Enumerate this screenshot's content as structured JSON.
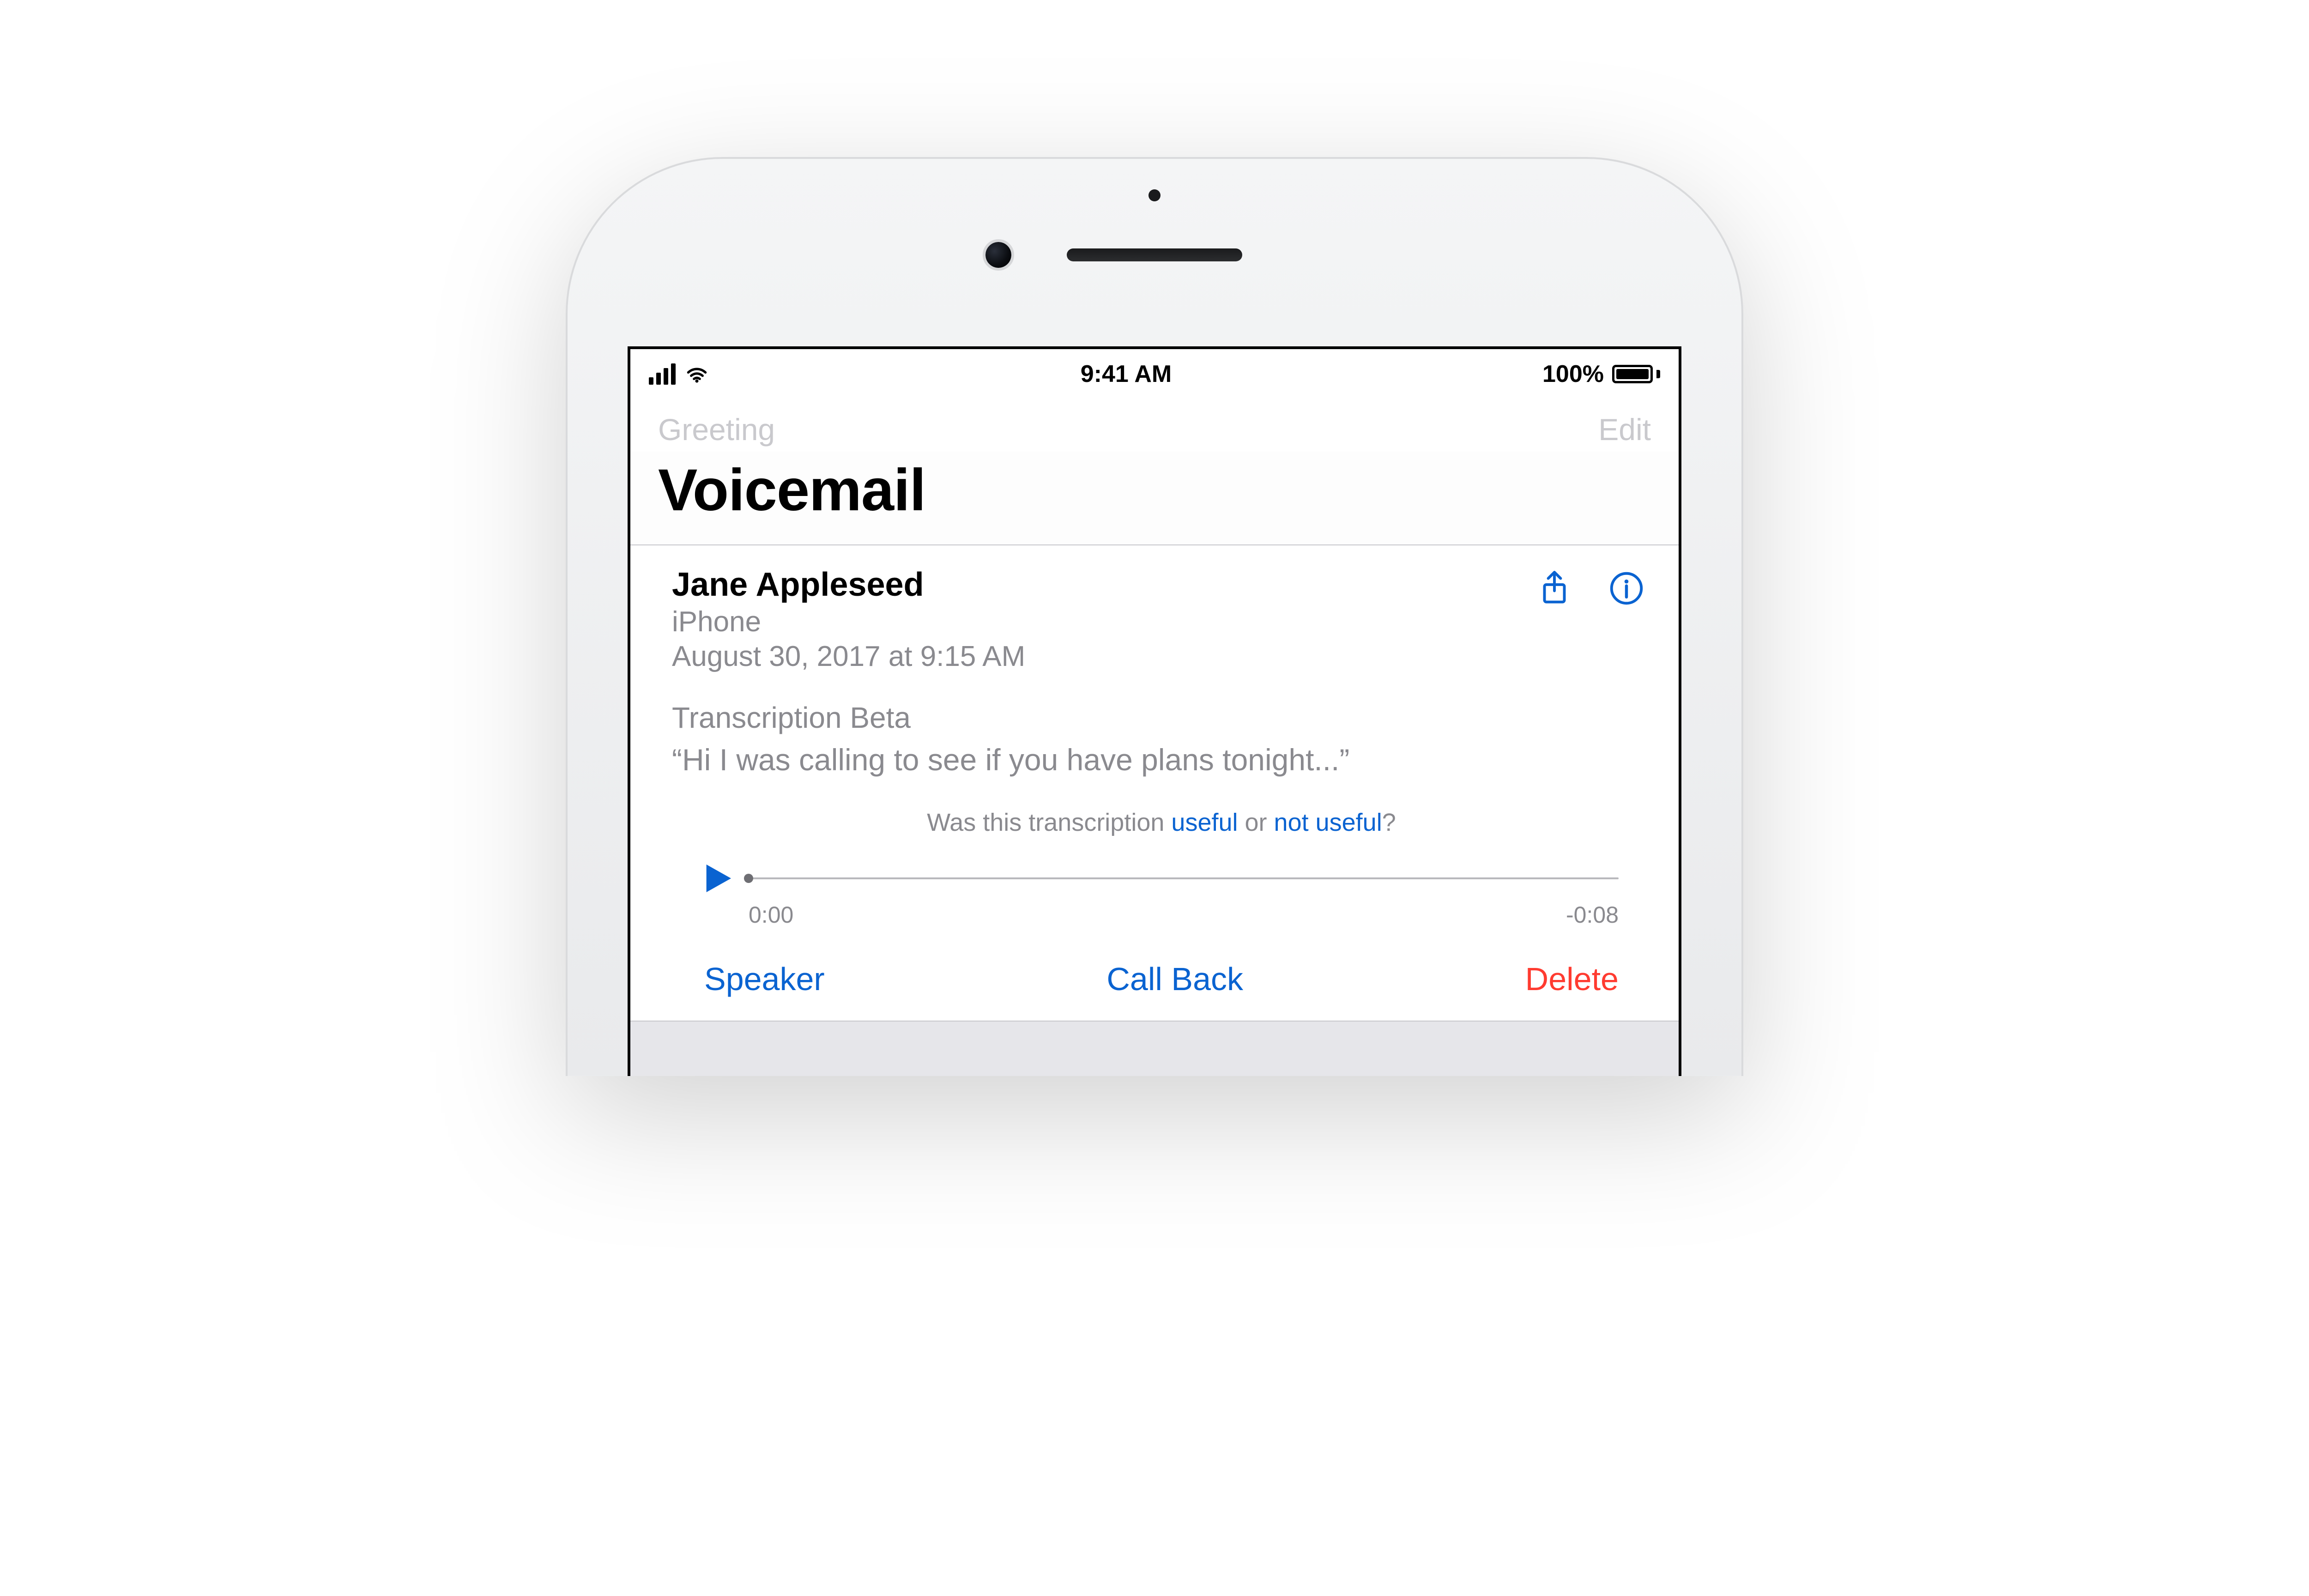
{
  "status_bar": {
    "time": "9:41 AM",
    "battery_text": "100%"
  },
  "nav": {
    "left": "Greeting",
    "right": "Edit"
  },
  "header": {
    "title": "Voicemail"
  },
  "voicemail": {
    "caller_name": "Jane Appleseed",
    "caller_device": "iPhone",
    "timestamp": "August 30, 2017 at 9:15 AM",
    "transcription_label": "Transcription Beta",
    "transcription_text": "“Hi I was calling to see if you have plans tonight...”",
    "feedback_prefix": "Was this transcription ",
    "feedback_useful": "useful",
    "feedback_or": " or ",
    "feedback_not_useful": "not useful",
    "feedback_suffix": "?"
  },
  "player": {
    "elapsed": "0:00",
    "remaining": "-0:08"
  },
  "actions": {
    "speaker": "Speaker",
    "call_back": "Call Back",
    "delete": "Delete"
  },
  "colors": {
    "accent": "#0a63d1",
    "destructive": "#ff3b30",
    "muted": "#8a8a8f"
  }
}
